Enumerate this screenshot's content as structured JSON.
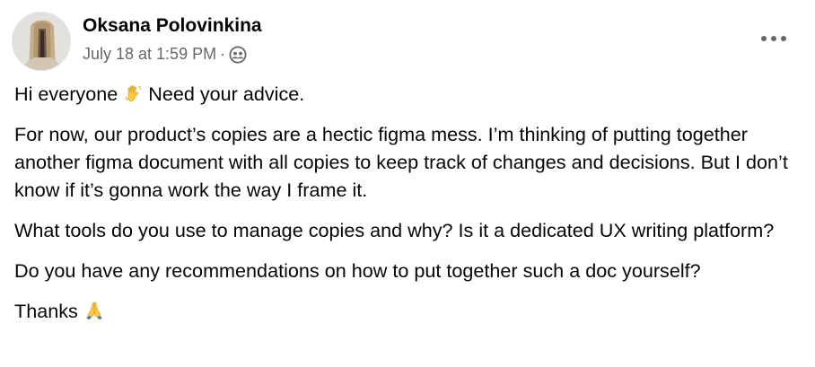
{
  "post": {
    "author": "Oksana Polovinkina",
    "timestamp": "July 18 at 1:59 PM",
    "separator": "·",
    "audience_icon": "friends-icon",
    "more_icon": "more-options-icon",
    "paragraphs": [
      {
        "text_before": "Hi everyone",
        "emoji": "waving-hand-emoji",
        "text_after": "Need your advice."
      },
      {
        "text": "For now, our product’s copies are a hectic figma mess. I’m thinking of putting together another figma document with all copies to keep track of changes and decisions. But I don’t know if it’s gonna work the way I frame it."
      },
      {
        "text": "What tools do you use to manage copies and why? Is it a dedicated UX writing platform?"
      },
      {
        "text": "Do you have any recommendations on how to put together such a doc yourself?"
      },
      {
        "text_before": "Thanks",
        "emoji": "folded-hands-emoji"
      }
    ]
  },
  "colors": {
    "primary_text": "#050505",
    "secondary_text": "#65676b",
    "emoji_yellow": "#ffc83d"
  }
}
